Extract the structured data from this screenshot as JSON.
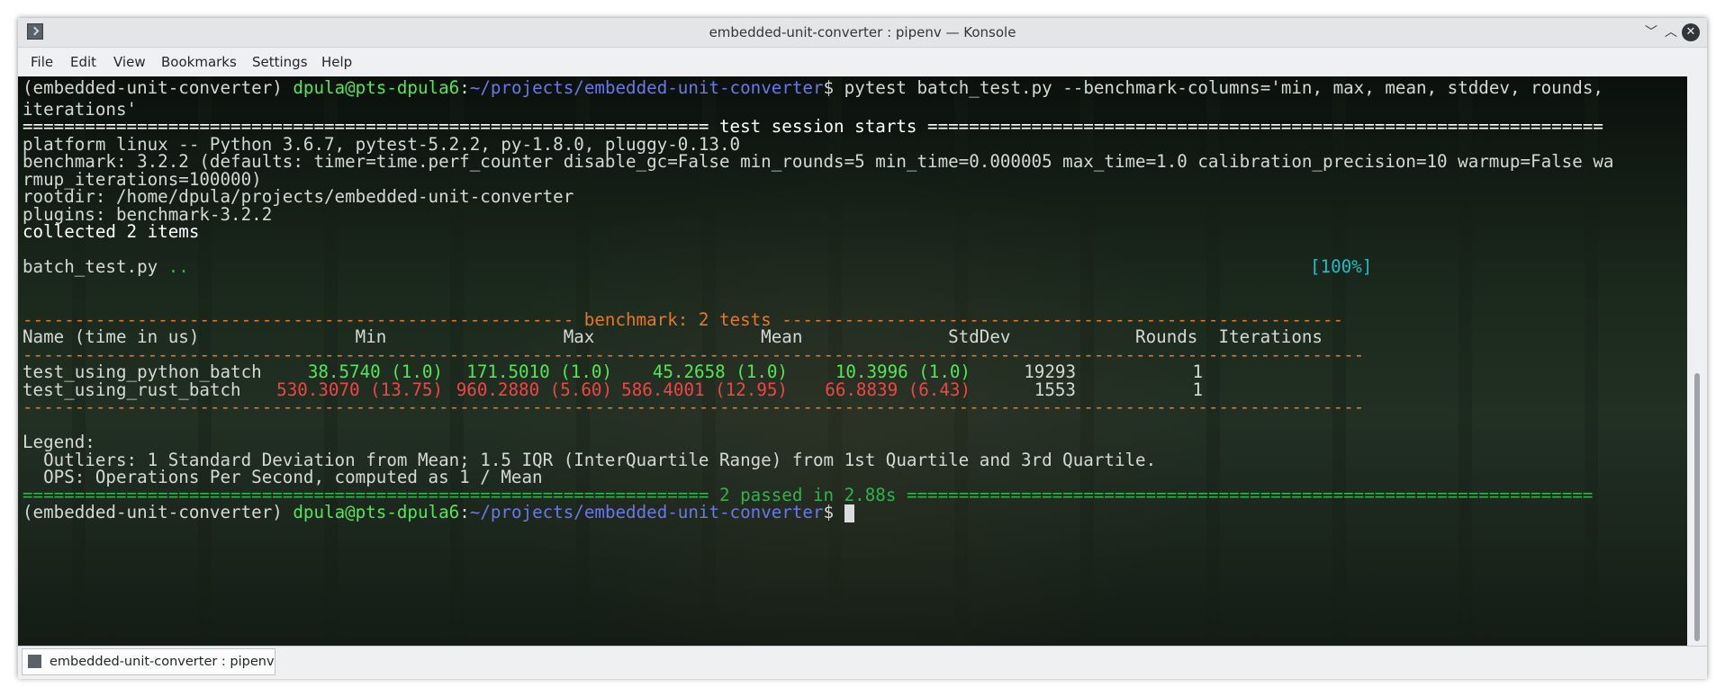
{
  "window": {
    "title": "embedded-unit-converter : pipenv — Konsole",
    "buttons": {
      "minimize": "﹀",
      "maximize": "︿",
      "close": "✕"
    }
  },
  "menu": [
    "File",
    "Edit",
    "View",
    "Bookmarks",
    "Settings",
    "Help"
  ],
  "terminal": {
    "prompt": {
      "env": "(embedded-unit-converter) ",
      "userhost": "dpula@pts-dpula6",
      "colon": ":",
      "path": "~/projects/embedded-unit-converter",
      "dollar": "$ "
    },
    "command_line1": "pytest batch_test.py --benchmark-columns='min, max, mean, stddev, rounds,",
    "command_line2": "iterations'",
    "session_left": "==================================================================",
    "session_title": " test session starts ",
    "session_right": "=================================================================",
    "platform": "platform linux -- Python 3.6.7, pytest-5.2.2, py-1.8.0, pluggy-0.13.0",
    "benchmark_line1": "benchmark: 3.2.2 (defaults: timer=time.perf_counter disable_gc=False min_rounds=5 min_time=0.000005 max_time=1.0 calibration_precision=10 warmup=False wa",
    "benchmark_line2": "rmup_iterations=100000)",
    "rootdir": "rootdir: /home/dpula/projects/embedded-unit-converter",
    "plugins": "plugins: benchmark-3.2.2",
    "collected": "collected 2 items",
    "test_file": "batch_test.py ",
    "test_dots": "..",
    "progress": "[100%]",
    "bench_left": "-----------------------------------------------------",
    "bench_title": " benchmark: 2 tests ",
    "bench_right": "------------------------------------------------------",
    "table_header": "Name (time in us)               Min                 Max                Mean              StdDev            Rounds  Iterations",
    "dashes": "---------------------------------------------------------------------------------------------------------------------------------",
    "rows": [
      {
        "name": "test_using_python_batch",
        "min": "38.5740 (1.0)",
        "max": "171.5010 (1.0)",
        "mean": "45.2658 (1.0)",
        "stddev": "10.3996 (1.0)",
        "rounds": "19293",
        "iterations": "1"
      },
      {
        "name": "test_using_rust_batch",
        "min": "530.3070 (13.75)",
        "max": "960.2880 (5.60)",
        "mean": "586.4001 (12.95)",
        "stddev": "66.8839 (6.43)",
        "rounds": "1553",
        "iterations": "1"
      }
    ],
    "legend_title": "Legend:",
    "legend_outliers": "  Outliers: 1 Standard Deviation from Mean; 1.5 IQR (InterQuartile Range) from 1st Quartile and 3rd Quartile.",
    "legend_ops": "  OPS: Operations Per Second, computed as 1 / Mean",
    "result_left": "==================================================================",
    "result_title": " 2 passed in 2.88s ",
    "result_right": "=================================================================="
  },
  "tab": {
    "label": "embedded-unit-converter : pipenv"
  },
  "colors": {
    "prompt_user": "#54e654",
    "prompt_path": "#6a78e8",
    "benchmark_header": "#e07a2a",
    "pass": "#2fb34a",
    "fast": "#54e654",
    "slow": "#f04545",
    "progress": "#1fbcc6"
  }
}
